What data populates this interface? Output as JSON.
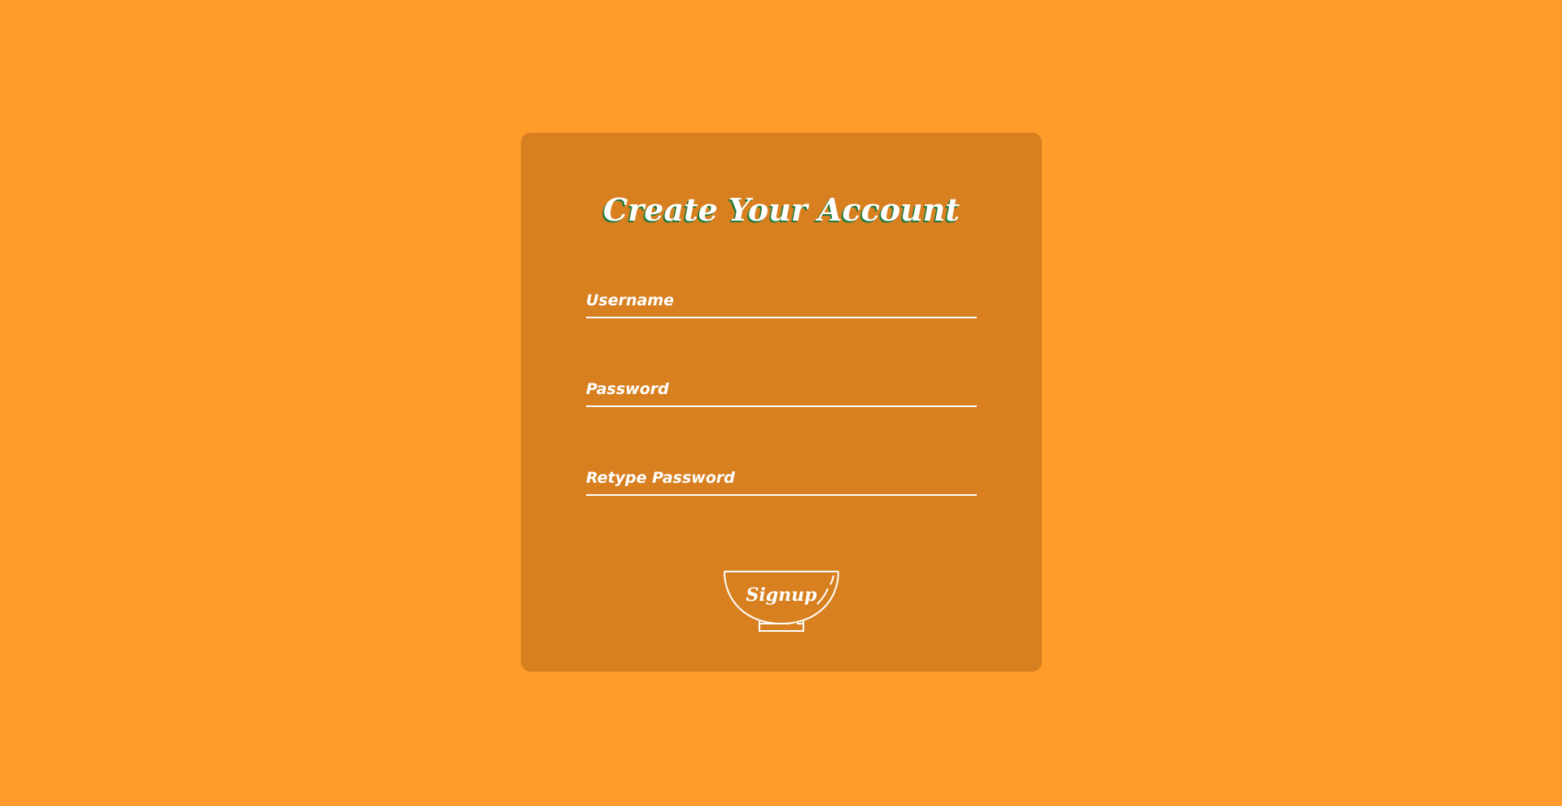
{
  "form": {
    "title": "Create Your Account",
    "username_placeholder": "Username",
    "password_placeholder": "Password",
    "retype_placeholder": "Retype Password",
    "signup_label": "Signup"
  },
  "colors": {
    "background": "#FF9C2A",
    "card": "#D88020",
    "text": "#FFFFFF",
    "title_shadow": "#1E7A3A"
  },
  "icons": {
    "signup_button_shape": "bowl-icon"
  }
}
